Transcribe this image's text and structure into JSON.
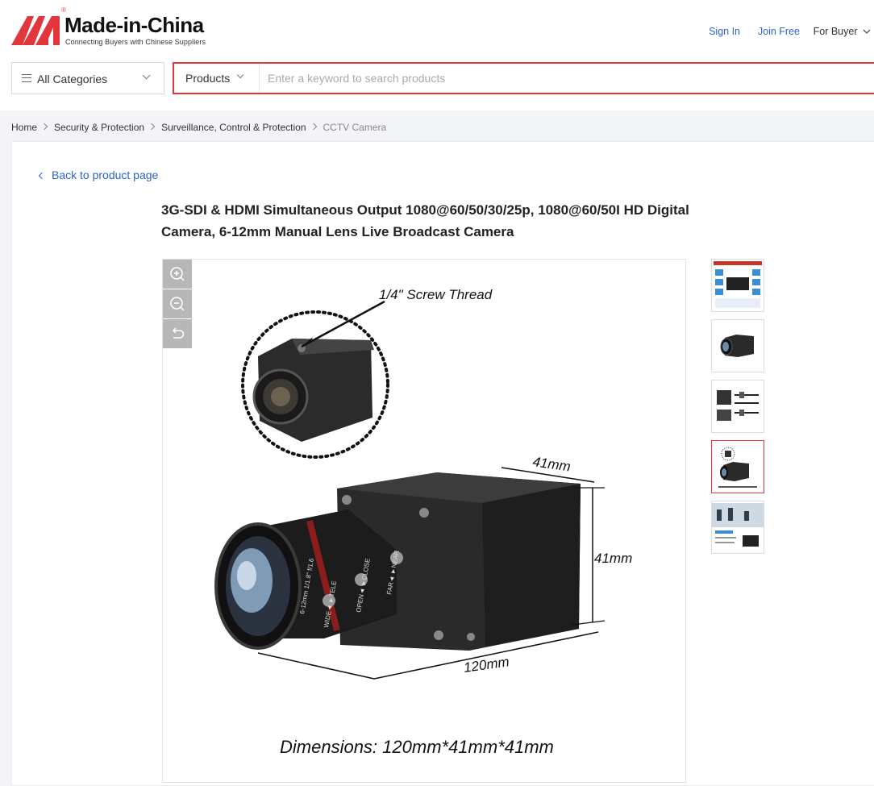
{
  "header": {
    "logo": {
      "brand": "Made-in-China",
      "tagline": "Connecting Buyers with Chinese Suppliers",
      "registered": "®",
      "icon": "made-in-china-logo-icon"
    },
    "links": {
      "sign_in": "Sign In",
      "join_free": "Join Free",
      "for_buyer": "For Buyer"
    }
  },
  "search": {
    "category_label": "All Categories",
    "type_label": "Products",
    "placeholder": "Enter a keyword to search products",
    "value": ""
  },
  "breadcrumb": [
    "Home",
    "Security & Protection",
    "Surveillance, Control & Protection",
    "CCTV Camera"
  ],
  "main": {
    "back_link": "Back to product page",
    "title": "3G-SDI & HDMI Simultaneous Output 1080@60/50/30/25p, 1080@60/50I HD Digital Camera, 6-12mm Manual Lens Live Broadcast Camera",
    "image": {
      "screw_label": "1/4\" Screw Thread",
      "dim_depth": "41mm",
      "dim_height": "41mm",
      "dim_length": "120mm",
      "lens_text_1": "6-12mm 1/1.8\" f/1.6",
      "lens_text_2": "WIDE◄ ►TELE",
      "lens_text_3": "OPEN◄ ►CLOSE",
      "lens_text_4": "FAR◄ ►NEAR",
      "caption": "Dimensions: 120mm*41mm*41mm"
    },
    "tools": [
      "zoom-in-icon",
      "zoom-out-icon",
      "reset-icon"
    ],
    "thumbnails_count": 5,
    "active_thumbnail": 4
  },
  "colors": {
    "brand_red": "#e1363c",
    "link_blue": "#2a66c8",
    "tool_gray": "#b7b7b7"
  }
}
